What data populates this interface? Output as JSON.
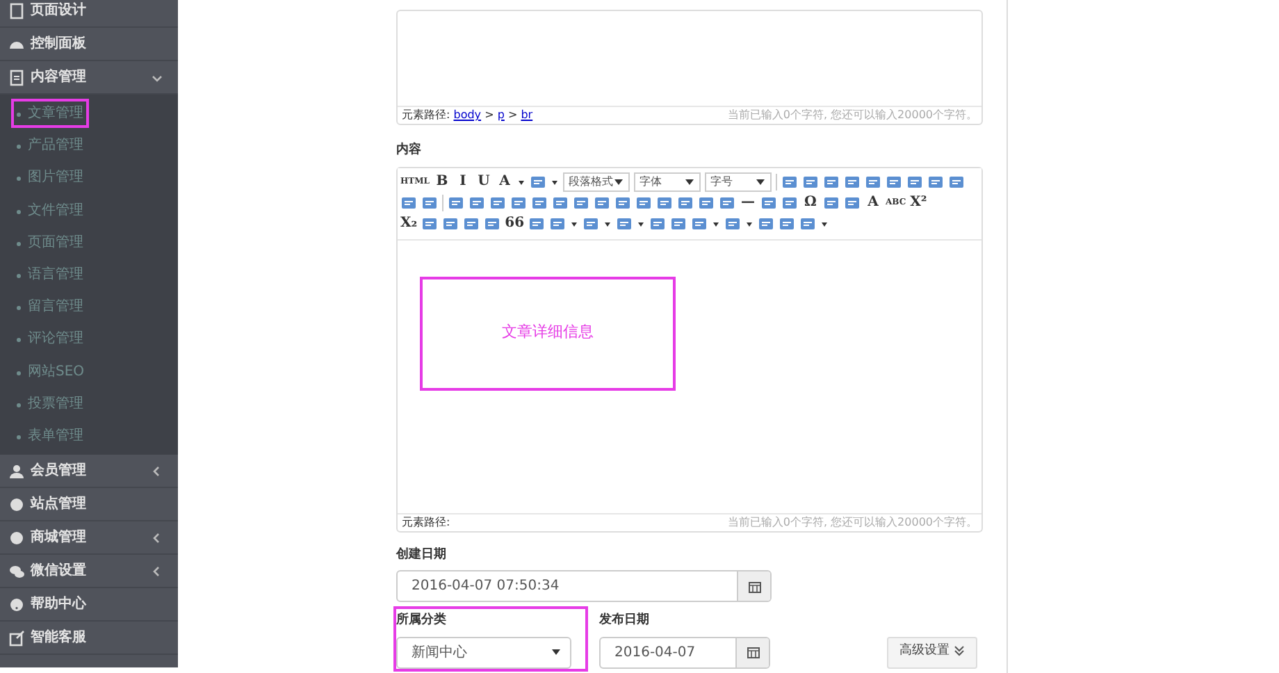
{
  "sidebar": {
    "items": [
      {
        "label": "页面设计"
      },
      {
        "label": "控制面板"
      },
      {
        "label": "内容管理",
        "expanded": true,
        "children": [
          {
            "label": "文章管理",
            "highlighted": true
          },
          {
            "label": "产品管理",
            "highlighted": false
          },
          {
            "label": "图片管理",
            "highlighted": false
          },
          {
            "label": "文件管理",
            "highlighted": false
          },
          {
            "label": "页面管理",
            "highlighted": false
          },
          {
            "label": "语言管理",
            "highlighted": false
          },
          {
            "label": "留言管理",
            "highlighted": false
          },
          {
            "label": "评论管理",
            "highlighted": false
          },
          {
            "label": "网站SEO",
            "highlighted": false
          },
          {
            "label": "投票管理",
            "highlighted": false
          },
          {
            "label": "表单管理",
            "highlighted": false
          }
        ]
      },
      {
        "label": "会员管理",
        "expanded": false
      },
      {
        "label": "站点管理"
      },
      {
        "label": "商城管理",
        "expanded": false
      },
      {
        "label": "微信设置",
        "expanded": false
      },
      {
        "label": "帮助中心"
      },
      {
        "label": "智能客服"
      }
    ]
  },
  "summary_editor": {
    "path_label": "元素路径:",
    "path": [
      "body",
      "p",
      "br"
    ],
    "path_sep": ">",
    "counter": "当前已输入0个字符, 您还可以输入20000个字符。"
  },
  "content_editor": {
    "label": "内容",
    "toolbar": [
      [
        {
          "kind": "glyph",
          "text": "HTML"
        },
        {
          "kind": "glyph",
          "text": "B"
        },
        {
          "kind": "glyph",
          "text": "I"
        },
        {
          "kind": "glyph",
          "text": "U"
        },
        {
          "kind": "glyph",
          "text": "A",
          "dropdown": true
        },
        {
          "kind": "icon",
          "dropdown": true
        },
        {
          "kind": "select",
          "value": "段落格式"
        },
        {
          "kind": "select",
          "value": "字体"
        },
        {
          "kind": "select",
          "value": "字号"
        },
        {
          "kind": "sep"
        },
        {
          "kind": "icon"
        },
        {
          "kind": "icon"
        },
        {
          "kind": "icon"
        },
        {
          "kind": "icon"
        },
        {
          "kind": "icon"
        },
        {
          "kind": "icon"
        },
        {
          "kind": "icon"
        },
        {
          "kind": "icon"
        },
        {
          "kind": "icon"
        }
      ],
      [
        {
          "kind": "icon"
        },
        {
          "kind": "icon"
        },
        {
          "kind": "sep"
        },
        {
          "kind": "icon"
        },
        {
          "kind": "icon"
        },
        {
          "kind": "icon"
        },
        {
          "kind": "icon"
        },
        {
          "kind": "icon"
        },
        {
          "kind": "icon"
        },
        {
          "kind": "icon"
        },
        {
          "kind": "icon"
        },
        {
          "kind": "icon"
        },
        {
          "kind": "icon"
        },
        {
          "kind": "icon"
        },
        {
          "kind": "icon"
        },
        {
          "kind": "icon"
        },
        {
          "kind": "icon"
        },
        {
          "kind": "glyph",
          "text": "—"
        },
        {
          "kind": "icon"
        },
        {
          "kind": "icon"
        },
        {
          "kind": "glyph",
          "text": "Ω"
        },
        {
          "kind": "icon"
        },
        {
          "kind": "icon"
        },
        {
          "kind": "glyph",
          "text": "A"
        },
        {
          "kind": "glyph",
          "text": "ABC"
        },
        {
          "kind": "glyph",
          "text": "X²"
        }
      ],
      [
        {
          "kind": "glyph",
          "text": "X₂"
        },
        {
          "kind": "icon"
        },
        {
          "kind": "icon"
        },
        {
          "kind": "icon"
        },
        {
          "kind": "icon"
        },
        {
          "kind": "glyph",
          "text": "66"
        },
        {
          "kind": "icon"
        },
        {
          "kind": "icon",
          "dropdown": true
        },
        {
          "kind": "icon",
          "dropdown": true
        },
        {
          "kind": "icon",
          "dropdown": true
        },
        {
          "kind": "icon"
        },
        {
          "kind": "icon"
        },
        {
          "kind": "icon",
          "dropdown": true
        },
        {
          "kind": "icon",
          "dropdown": true
        },
        {
          "kind": "icon"
        },
        {
          "kind": "icon"
        },
        {
          "kind": "icon",
          "dropdown": true
        }
      ]
    ],
    "note": "文章详细信息",
    "path_label": "元素路径:",
    "counter": "当前已输入0个字符, 您还可以输入20000个字符。"
  },
  "created_date": {
    "label": "创建日期",
    "value": "2016-04-07 07:50:34"
  },
  "category": {
    "label": "所属分类",
    "value": "新闻中心",
    "highlighted": true
  },
  "publish_date": {
    "label": "发布日期",
    "value": "2016-04-07"
  },
  "advanced_button": "高级设置"
}
